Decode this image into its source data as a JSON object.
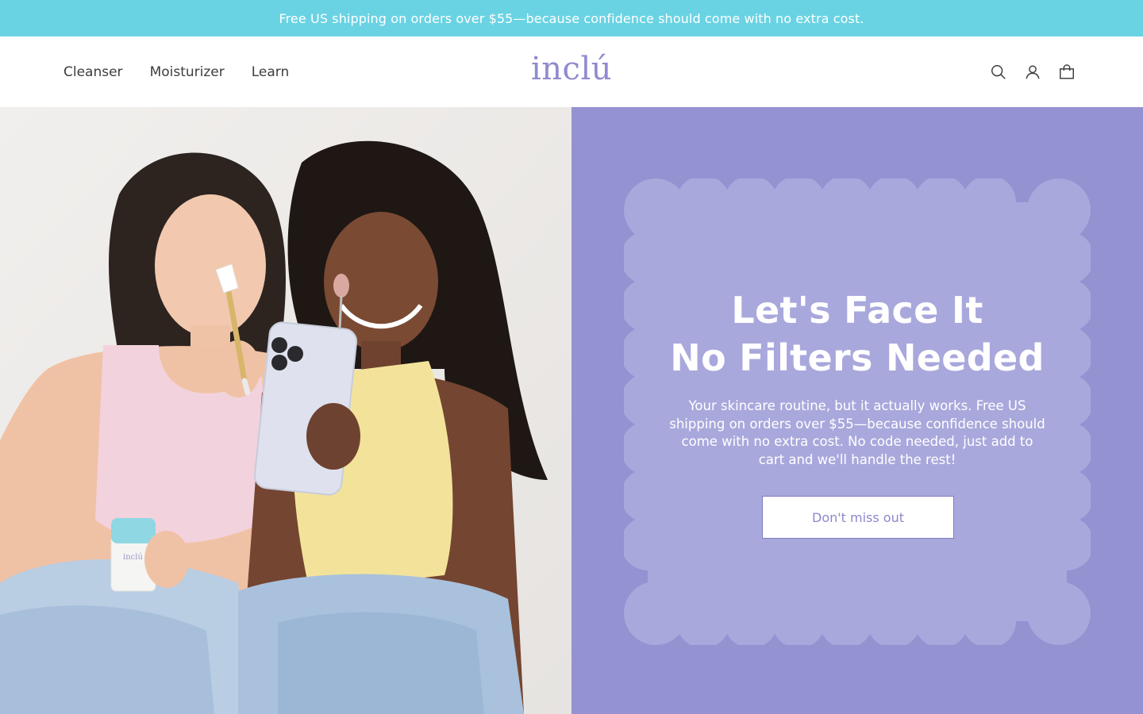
{
  "announcement": {
    "text": "Free US shipping on orders over $55—because confidence should come with no extra cost."
  },
  "header": {
    "nav": [
      {
        "label": "Cleanser"
      },
      {
        "label": "Moisturizer"
      },
      {
        "label": "Learn"
      }
    ],
    "logo": "inclú",
    "icons": [
      "search-icon",
      "account-icon",
      "cart-icon"
    ]
  },
  "hero": {
    "title_line1": "Let's Face It",
    "title_line2": "No Filters Needed",
    "body": "Your skincare routine, but it actually works. Free US shipping on orders over $55—because confidence should come with no extra cost. No code needed, just add to cart and we'll handle the rest!",
    "cta_label": "Don't miss out",
    "jar_label": "inclú"
  },
  "colors": {
    "announcement_bg": "#6ad3e3",
    "panel_bg": "#9492d1",
    "scallop_bg": "#a9a8dc",
    "logo": "#8f8bcf",
    "cta_text": "#8c88cc"
  }
}
